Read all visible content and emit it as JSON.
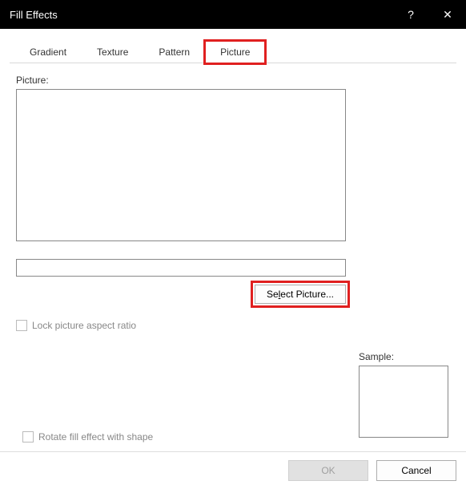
{
  "titlebar": {
    "title": "Fill Effects",
    "help": "?",
    "close": "✕"
  },
  "tabs": {
    "gradient": "Gradient",
    "texture": "Texture",
    "pattern": "Pattern",
    "picture": "Picture"
  },
  "labels": {
    "picture_section": "Picture:",
    "sample": "Sample:"
  },
  "buttons": {
    "select_picture": "Se_lect Picture...",
    "ok": "OK",
    "cancel": "Cancel"
  },
  "checkboxes": {
    "lock_ratio": "Lock picture aspect ratio",
    "rotate_fill": "Rotate fill effect with shape"
  },
  "inputs": {
    "picture_name": ""
  }
}
